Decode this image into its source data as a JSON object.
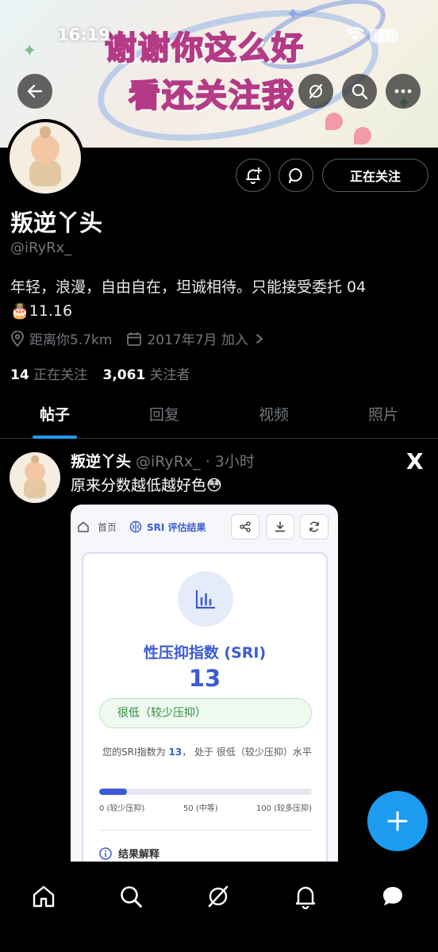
{
  "status_bar": {
    "time": "16:19",
    "battery": "32"
  },
  "banner": {
    "line1": "谢谢你这么好",
    "line2": "看还关注我"
  },
  "profile": {
    "name": "叛逆丫头",
    "handle": "@iRyRx_",
    "bio": "年轻，浪漫，自由自在，坦诚相待。只能接受委托 04",
    "birthday": "11.16",
    "birthday_icon": "🎂",
    "location": "距离你5.7km",
    "joined": "2017年7月 加入",
    "following_count": "14",
    "following_label": "正在关注",
    "followers_count": "3,061",
    "followers_label": "关注者",
    "follow_button": "正在关注"
  },
  "tabs": [
    {
      "label": "帖子",
      "active": true
    },
    {
      "label": "回复",
      "active": false
    },
    {
      "label": "视频",
      "active": false
    },
    {
      "label": "照片",
      "active": false
    }
  ],
  "post": {
    "author": "叛逆丫头",
    "handle": "@iRyRx_",
    "time": "· 3小时",
    "text": "原来分数越低越好色",
    "emoji": "😳",
    "logo": "X"
  },
  "sri_card": {
    "home": "首页",
    "title_tab": "SRI 评估结果",
    "heading": "性压抑指数 (SRI)",
    "score": "13",
    "level": "很低（较少压抑）",
    "desc_prefix": "您的SRI指数为",
    "desc_value": "13",
    "desc_suffix": "， 处于 很低（较少压抑）水平",
    "progress_percent": 13,
    "tick_low": "0 (较少压抑)",
    "tick_mid": "50 (中等)",
    "tick_high": "100 (较多压抑)",
    "explain_title": "结果解释"
  },
  "colors": {
    "accent": "#1d9bf0",
    "sri_blue": "#3b5bd6",
    "muted": "#71767b"
  }
}
